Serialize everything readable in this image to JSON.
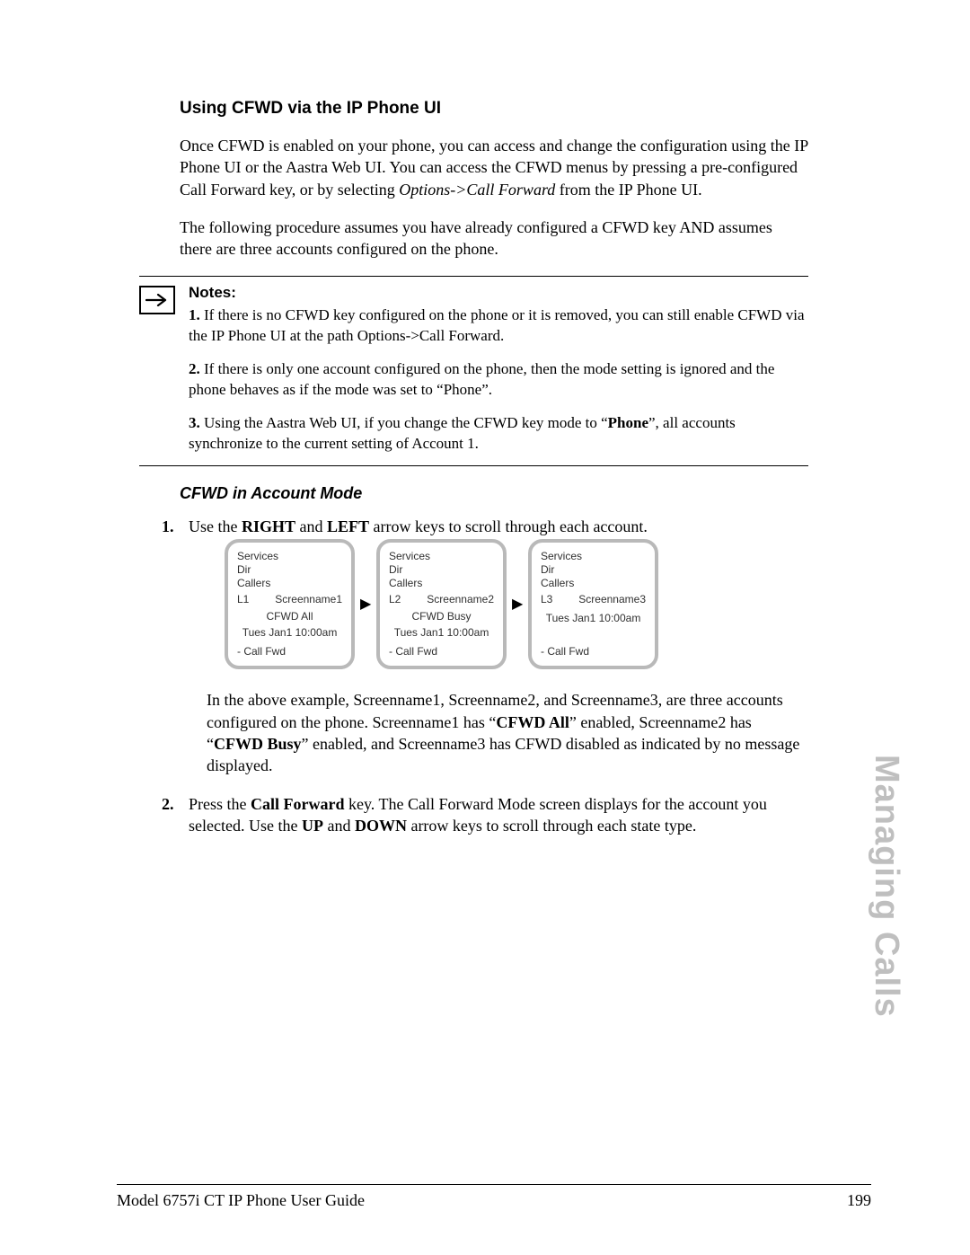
{
  "section_title": "Using CFWD via the IP Phone UI",
  "intro_p1_a": "Once CFWD is enabled on your phone, you can access and change the configuration using the IP Phone UI or the Aastra Web UI. You can access the CFWD menus by pressing a pre-configured Call Forward key, or by selecting ",
  "intro_p1_italic": "Options->Call Forward",
  "intro_p1_b": " from the IP Phone UI.",
  "intro_p2": "The following procedure assumes you have already configured a CFWD key AND assumes there are three accounts configured on the phone.",
  "notes_title": "Notes:",
  "notes": {
    "n1_num": "1.",
    "n1_text": "  If there is no CFWD key configured on the phone or it is removed, you can still enable CFWD via the IP Phone UI at the path Options->Call Forward.",
    "n2_num": "2.",
    "n2_text": "  If there is only one account configured on the phone, then the mode setting is ignored and the phone behaves as if the mode was set to “Phone”.",
    "n3_num": "3.",
    "n3_a": "  Using the Aastra Web UI, if you change the CFWD key mode to “",
    "n3_bold": "Phone",
    "n3_b": "”, all accounts synchronize to the current setting of Account 1."
  },
  "subsection": "CFWD in Account Mode",
  "steps": {
    "s1_a": "Use the ",
    "s1_b1": "RIGHT",
    "s1_mid": " and ",
    "s1_b2": "LEFT",
    "s1_c": " arrow keys to scroll through each account.",
    "s2_a": "Press the ",
    "s2_bold": "Call Forward",
    "s2_b": " key. The Call Forward Mode screen displays for the account you selected. Use the ",
    "s2_bold2": "UP",
    "s2_mid": " and ",
    "s2_bold3": "DOWN",
    "s2_c": " arrow keys to scroll through each state type."
  },
  "screens": [
    {
      "services": "Services",
      "dir": "Dir",
      "callers": "Callers",
      "line": "L1",
      "name": "Screenname1",
      "cfwd": "CFWD All",
      "time": "Tues Jan1 10:00am",
      "foot": "- Call Fwd"
    },
    {
      "services": "Services",
      "dir": "Dir",
      "callers": "Callers",
      "line": "L2",
      "name": "Screenname2",
      "cfwd": "CFWD Busy",
      "time": "Tues Jan1 10:00am",
      "foot": "- Call Fwd"
    },
    {
      "services": "Services",
      "dir": "Dir",
      "callers": "Callers",
      "line": "L3",
      "name": "Screenname3",
      "cfwd": "",
      "time": "Tues Jan1 10:00am",
      "foot": "- Call Fwd"
    }
  ],
  "arrow_glyph": "▶",
  "example_a": "In the above example, Screenname1, Screenname2, and Screenname3, are three accounts configured on the phone. Screenname1 has “",
  "example_b1": "CFWD All",
  "example_mid": "” enabled, Screenname2 has “",
  "example_b2": "CFWD Busy",
  "example_c": "” enabled, and Screenname3 has CFWD disabled as indicated by no message displayed.",
  "side_tab": "Managing Calls",
  "footer_left": "Model 6757i CT IP Phone User Guide",
  "footer_right": "199"
}
